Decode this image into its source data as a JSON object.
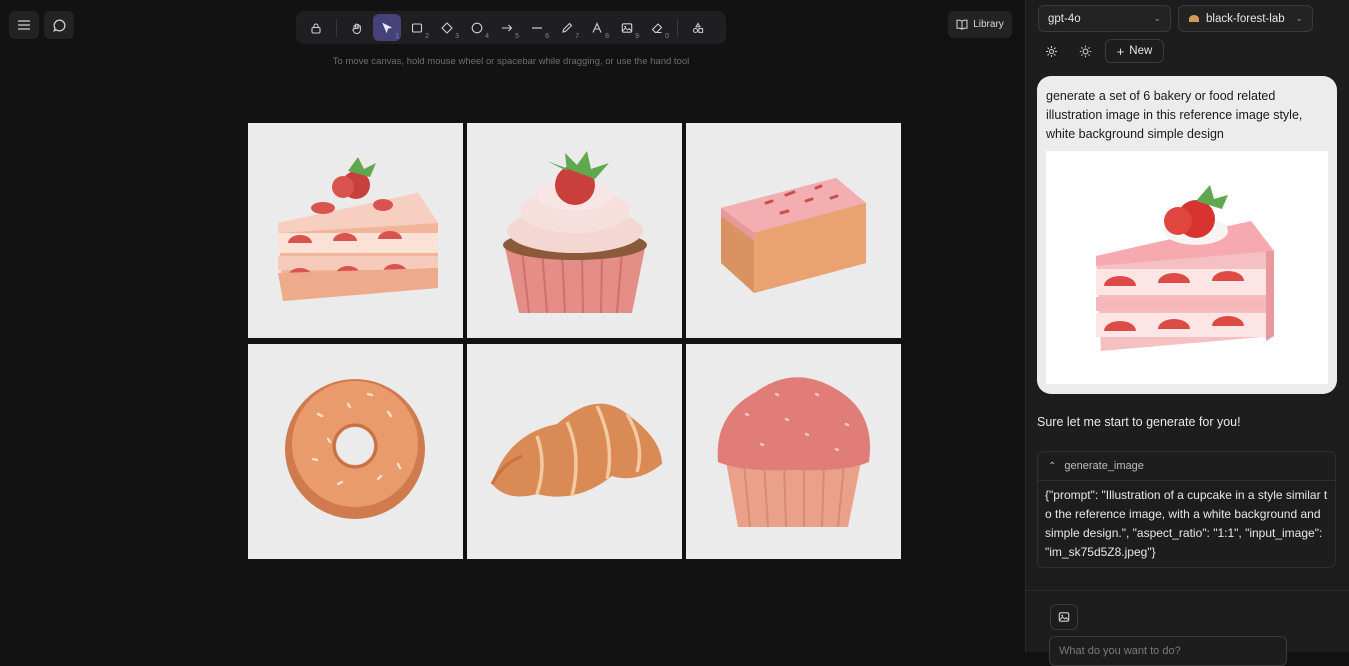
{
  "toolbar": {
    "hint": "To move canvas, hold mouse wheel or spacebar while dragging, or use the hand tool",
    "tools": [
      {
        "icon": "lock-icon",
        "num": ""
      },
      {
        "icon": "hand-icon",
        "num": ""
      },
      {
        "icon": "cursor-icon",
        "num": "1"
      },
      {
        "icon": "rectangle-icon",
        "num": "2"
      },
      {
        "icon": "diamond-icon",
        "num": "3"
      },
      {
        "icon": "circle-icon",
        "num": "4"
      },
      {
        "icon": "arrow-icon",
        "num": "5"
      },
      {
        "icon": "line-icon",
        "num": "6"
      },
      {
        "icon": "pencil-icon",
        "num": "7"
      },
      {
        "icon": "text-icon",
        "num": "8"
      },
      {
        "icon": "image-icon",
        "num": "9"
      },
      {
        "icon": "eraser-icon",
        "num": "0"
      },
      {
        "icon": "shapes-icon",
        "num": ""
      }
    ]
  },
  "header": {
    "library_label": "Library"
  },
  "canvas": {
    "tiles": [
      "strawberry-cake",
      "cupcake",
      "pound-cake",
      "donut",
      "croissant",
      "muffin"
    ]
  },
  "sidebar": {
    "text_model": "gpt-4o",
    "image_model": "black-forest-lab",
    "new_label": "New",
    "user_message": "generate a set of 6 bakery or food related illustration image in this reference image style, white background simple design",
    "assistant_message": "Sure let me start to generate for you!",
    "tool_call_name": "generate_image",
    "tool_call_args": "{\"prompt\": \"Illustration of a cupcake in a style similar to the reference image, with a white background and simple design.\", \"aspect_ratio\": \"1:1\", \"input_image\": \"im_sk75d5Z8.jpeg\"}",
    "input_placeholder": "What do you want to do?"
  },
  "colors": {
    "accent": "#45427a",
    "canvas_bg": "#121212",
    "sidebar_bg": "#1d1d1d"
  }
}
